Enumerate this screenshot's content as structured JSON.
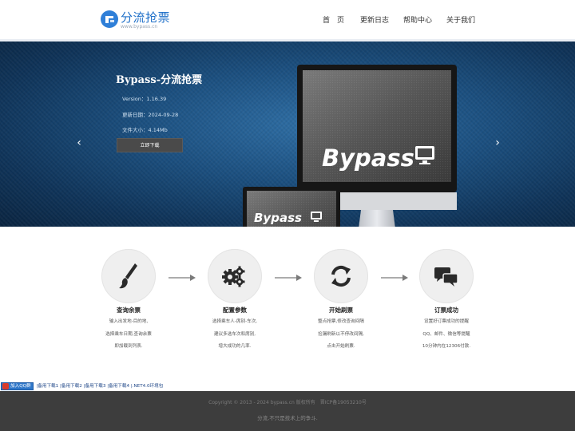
{
  "header": {
    "logo_title": "分流抢票",
    "logo_sub": "www.bypass.cn",
    "nav": [
      "首　页",
      "更新日志",
      "帮助中心",
      "关于我们"
    ]
  },
  "banner": {
    "title": "Bypass-分流抢票",
    "version": "Version：1.16.39",
    "date": "更新日期：2024-09-28",
    "size": "文件大小：4.14Mb",
    "download_label": "立即下载",
    "prev_arrow": "‹",
    "next_arrow": "›",
    "screen_brand": "Bypass"
  },
  "steps": [
    {
      "title": "查询余票",
      "lines": [
        "输入出发地-目的地,",
        "选择乘车日期,查询余票",
        "即加载到列表."
      ],
      "icon": "brush-icon"
    },
    {
      "title": "配置参数",
      "lines": [
        "选择乘车人-席别-车次,",
        "建议多选车次和席别,",
        "增大成功的几率."
      ],
      "icon": "gears-icon"
    },
    {
      "title": "开始刷票",
      "lines": [
        "整点抢票,修改查询间隔",
        "捡漏刷新以不停改间隔,",
        "点击开始刷票."
      ],
      "icon": "refresh-icon"
    },
    {
      "title": "订票成功",
      "lines": [
        "设置好订票成功的提醒",
        "QQ、邮件、微信等提醒",
        "10分钟内在12306付款."
      ],
      "icon": "chat-icon"
    }
  ],
  "links": {
    "qq_label": "加入QQ群",
    "items": [
      "备用下载1",
      "备用下载2",
      "备用下载3",
      "备用下载4",
      ".NET4.0环境包"
    ],
    "separator": "|"
  },
  "footer": {
    "copyright": "Copyright © 2013 - 2024 bypass.cn 版权所有　晋ICP备19053210号",
    "slogan": "分流,不只是技术上的争斗."
  },
  "colors": {
    "brand_blue": "#2f7fd8",
    "banner_dark": "#0f3358",
    "footer_bg": "#3d3d3d"
  }
}
